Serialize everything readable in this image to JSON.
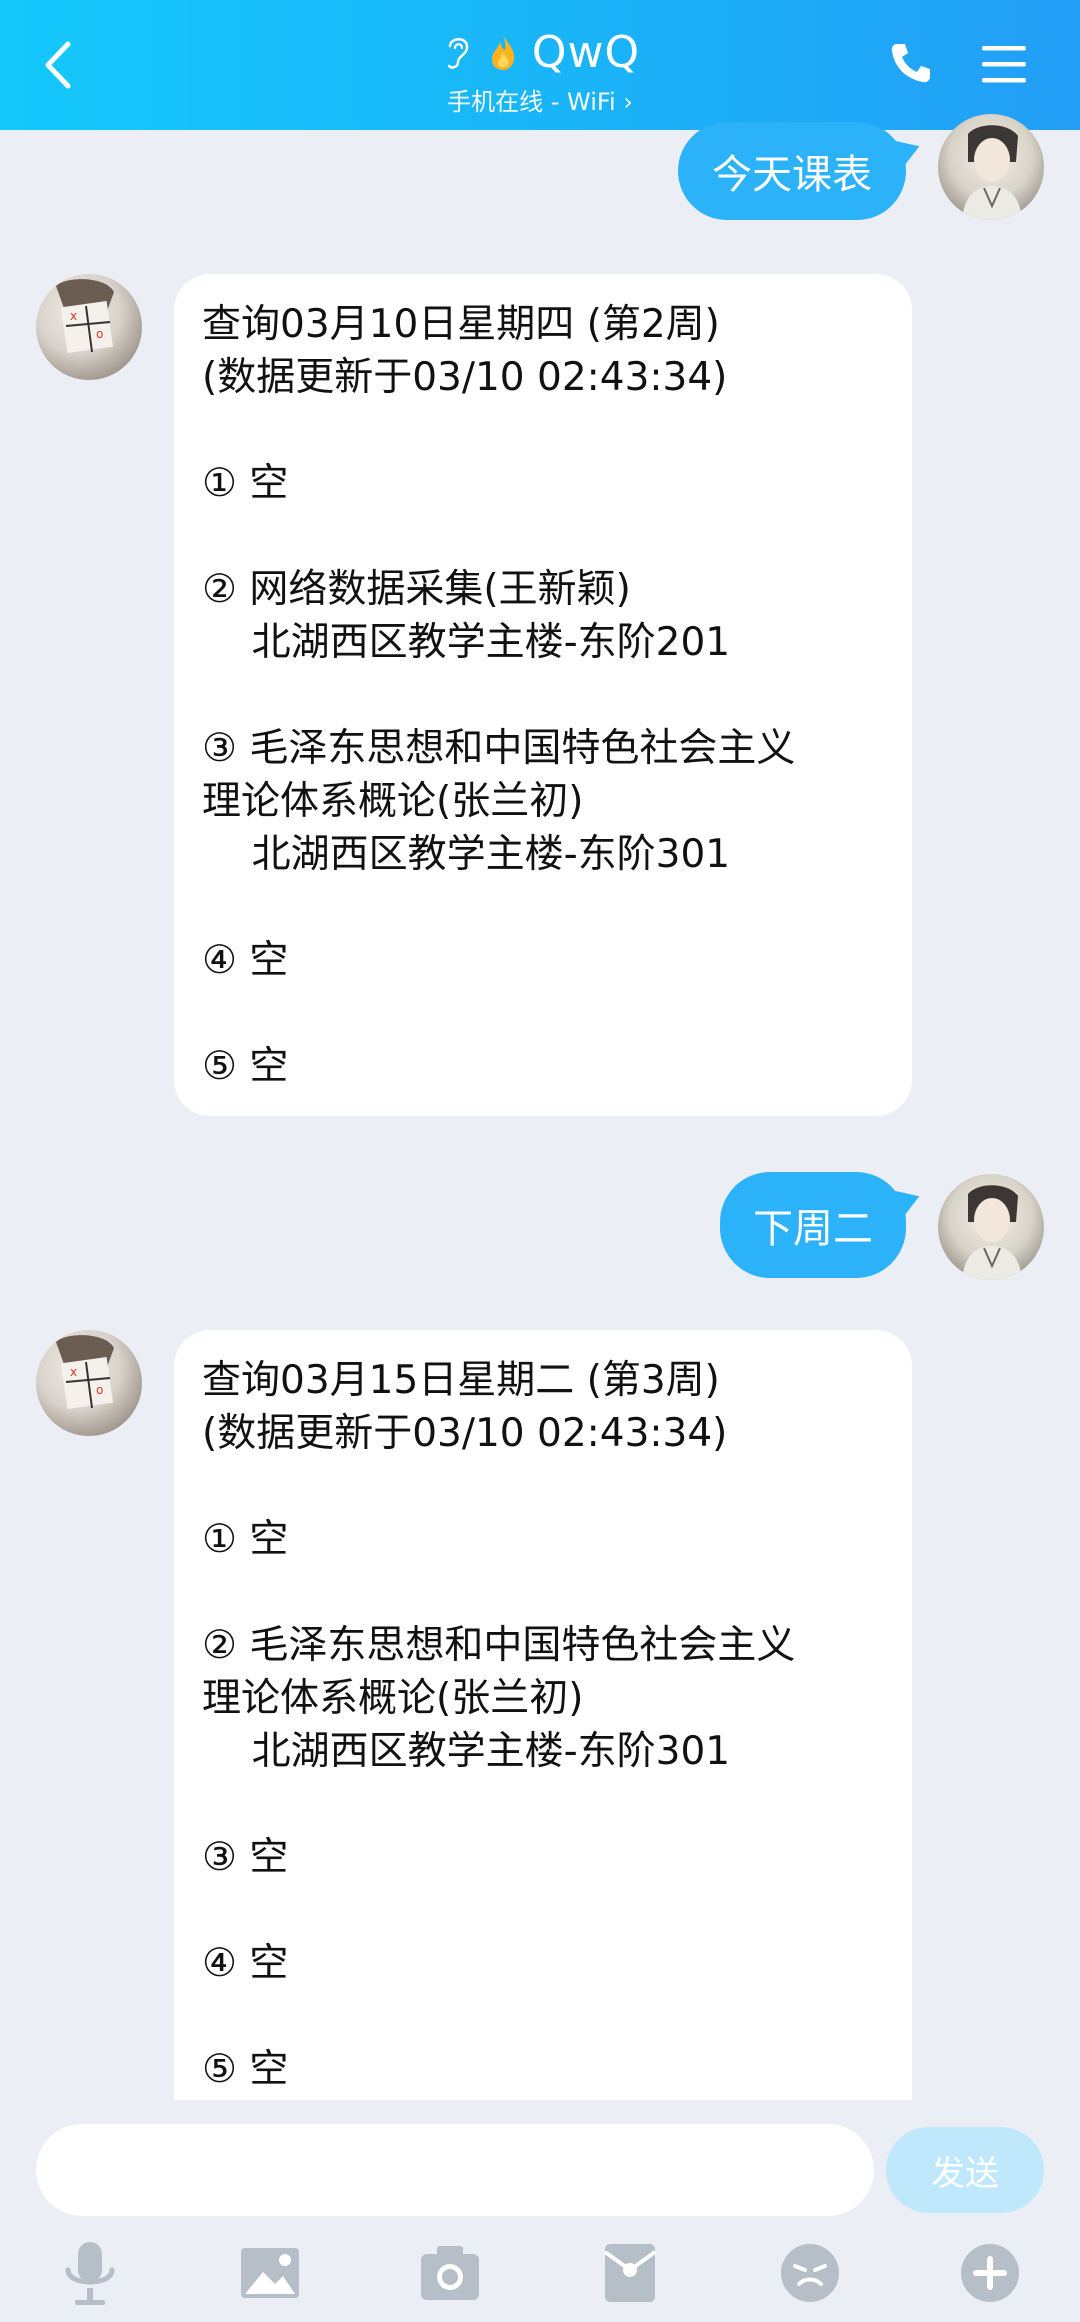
{
  "header": {
    "title": "QwQ",
    "subtitle": "手机在线 - WiFi ›"
  },
  "messages": [
    {
      "sender": "user",
      "text": "今天课表"
    },
    {
      "sender": "bot",
      "lines": [
        "查询03月10日星期四 (第2周)",
        "(数据更新于03/10 02:43:34)",
        "",
        "① 空",
        "",
        "② 网络数据采集(王新颖)",
        "    北湖西区教学主楼-东阶201",
        "",
        "③ 毛泽东思想和中国特色社会主义",
        "理论体系概论(张兰初)",
        "    北湖西区教学主楼-东阶301",
        "",
        "④ 空",
        "",
        "⑤ 空"
      ]
    },
    {
      "sender": "user",
      "text": "下周二"
    },
    {
      "sender": "bot",
      "lines": [
        "查询03月15日星期二 (第3周)",
        "(数据更新于03/10 02:43:34)",
        "",
        "① 空",
        "",
        "② 毛泽东思想和中国特色社会主义",
        "理论体系概论(张兰初)",
        "    北湖西区教学主楼-东阶301",
        "",
        "③ 空",
        "",
        "④ 空",
        "",
        "⑤ 空"
      ]
    }
  ],
  "input": {
    "value": "",
    "send_label": "发送"
  },
  "toolbar": [
    "mic-icon",
    "image-icon",
    "camera-icon",
    "red-packet-icon",
    "emoji-icon",
    "plus-icon"
  ],
  "colors": {
    "header_start": "#14c8fb",
    "header_end": "#239ef6",
    "user_bubble": "#2cb2f8",
    "background": "#ebeef5",
    "send_disabled": "#bfe8fc"
  }
}
